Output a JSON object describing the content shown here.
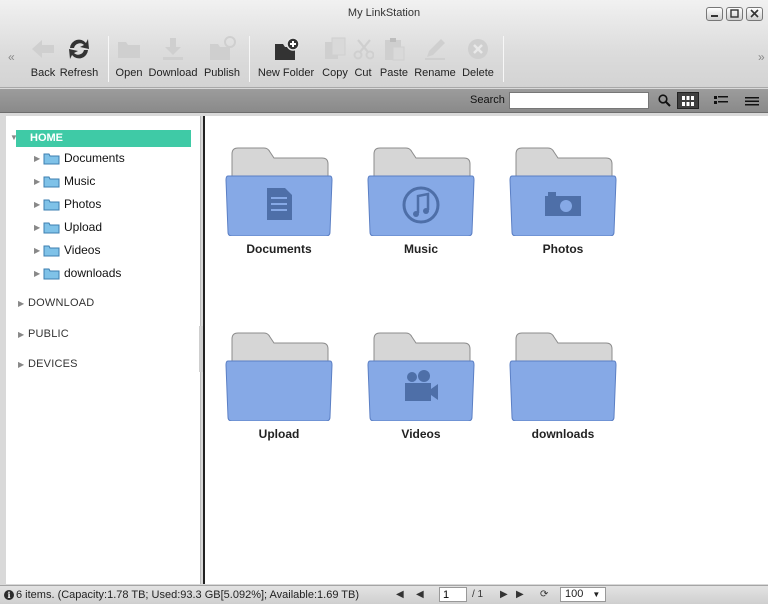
{
  "window": {
    "title": "My LinkStation",
    "minimize_icon": "minimize-icon",
    "restore_icon": "restore-icon",
    "close_icon": "close-icon"
  },
  "toolbar": {
    "scroll_left": "«",
    "scroll_right": "»",
    "buttons": [
      {
        "label": "Back",
        "icon": "back-arrow-icon",
        "enabled": false
      },
      {
        "label": "Refresh",
        "icon": "refresh-icon",
        "enabled": true
      },
      {
        "label": "Open",
        "icon": "open-folder-icon",
        "enabled": false
      },
      {
        "label": "Download",
        "icon": "download-icon",
        "enabled": false
      },
      {
        "label": "Publish",
        "icon": "publish-icon",
        "enabled": false
      },
      {
        "label": "New Folder",
        "icon": "new-folder-icon",
        "enabled": true
      },
      {
        "label": "Copy",
        "icon": "copy-icon",
        "enabled": false
      },
      {
        "label": "Cut",
        "icon": "cut-icon",
        "enabled": false
      },
      {
        "label": "Paste",
        "icon": "paste-icon",
        "enabled": false
      },
      {
        "label": "Rename",
        "icon": "rename-icon",
        "enabled": false
      },
      {
        "label": "Delete",
        "icon": "delete-icon",
        "enabled": false
      }
    ]
  },
  "search": {
    "label": "Search",
    "value": "",
    "search_icon": "magnifier-icon",
    "views": [
      "grid-view-icon",
      "list-view-icon",
      "detail-view-icon"
    ]
  },
  "sidebar": {
    "home_label": "HOME",
    "home_children": [
      "Documents",
      "Music",
      "Photos",
      "Upload",
      "Videos",
      "downloads"
    ],
    "roots": [
      "DOWNLOAD",
      "PUBLIC",
      "DEVICES"
    ]
  },
  "main": {
    "folders": [
      {
        "name": "Documents",
        "icon": "document-icon"
      },
      {
        "name": "Music",
        "icon": "music-note-icon"
      },
      {
        "name": "Photos",
        "icon": "camera-icon"
      },
      {
        "name": "Upload",
        "icon": ""
      },
      {
        "name": "Videos",
        "icon": "video-camera-icon"
      },
      {
        "name": "downloads",
        "icon": ""
      }
    ]
  },
  "status": {
    "info": "6 items. (Capacity:1.78 TB; Used:93.3 GB[5.092%]; Available:1.69 TB)",
    "page": "1",
    "page_total": "/ 1",
    "page_size": "100"
  },
  "colors": {
    "accent": "#3fcaa6",
    "folder_front": "#86a9e6",
    "folder_tab": "#d8d8d8"
  }
}
